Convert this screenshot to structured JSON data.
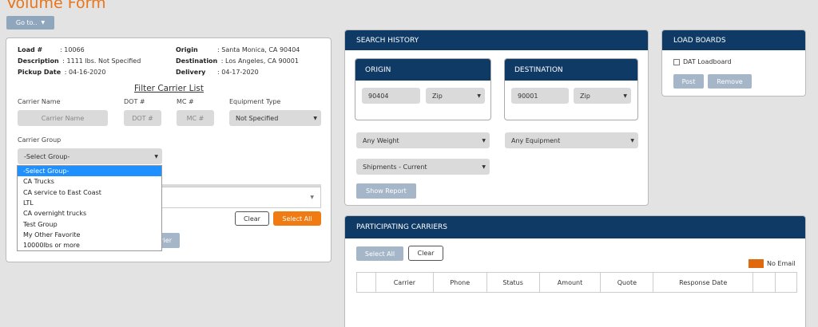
{
  "page": {
    "title": "Volume Form",
    "goto_label": "Go to..",
    "goto_caret": "▼"
  },
  "load": {
    "load_label": "Load #",
    "load_value": ": 10066",
    "description_label": "Description",
    "description_value": ": 1111 lbs. Not Specified",
    "pickup_label": "Pickup Date",
    "pickup_value": ": 04-16-2020",
    "origin_label": "Origin",
    "origin_value": ": Santa Monica, CA 90404",
    "destination_label": "Destination",
    "destination_value": ": Los Angeles, CA 90001",
    "delivery_label": "Delivery",
    "delivery_value": ": 04-17-2020"
  },
  "filter": {
    "title": "Filter Carrier List",
    "carrier_name_label": "Carrier Name",
    "carrier_name_placeholder": "Carrier Name",
    "dot_label": "DOT #",
    "dot_placeholder": "DOT #",
    "mc_label": "MC #",
    "mc_placeholder": "MC #",
    "equipment_label": "Equipment Type",
    "equipment_value": "Not Specified",
    "group_label": "Carrier Group",
    "group_value": "-Select Group-",
    "group_options": [
      "-Select Group-",
      "CA Trucks",
      "CA service to East Coast",
      "LTL",
      "CA overnight trucks",
      "Test Group",
      "My Other Favorite",
      "10000lbs or more"
    ],
    "clear_label": "Clear",
    "select_all_label": "Select All",
    "hidden_button_fragment": "rier"
  },
  "search_history": {
    "title": "SEARCH HISTORY",
    "origin_title": "ORIGIN",
    "origin_zip": "90404",
    "origin_type": "Zip",
    "destination_title": "DESTINATION",
    "destination_zip": "90001",
    "destination_type": "Zip",
    "weight_value": "Any Weight",
    "equipment_value": "Any Equipment",
    "shipments_value": "Shipments - Current",
    "show_report_label": "Show Report"
  },
  "load_boards": {
    "title": "LOAD BOARDS",
    "checkbox_label": "DAT Loadboard",
    "post_label": "Post",
    "remove_label": "Remove"
  },
  "carriers": {
    "title": "PARTICIPATING CARRIERS",
    "select_all_label": "Select All",
    "clear_label": "Clear",
    "legend_label": "No Email",
    "columns": [
      "",
      "Carrier",
      "Phone",
      "Status",
      "Amount",
      "Quote",
      "Response Date",
      "",
      ""
    ]
  },
  "colors": {
    "orange": "#f07b12",
    "navy": "#0f3a66",
    "muted_blue": "#a4b6c8",
    "no_email": "#e0690e"
  }
}
